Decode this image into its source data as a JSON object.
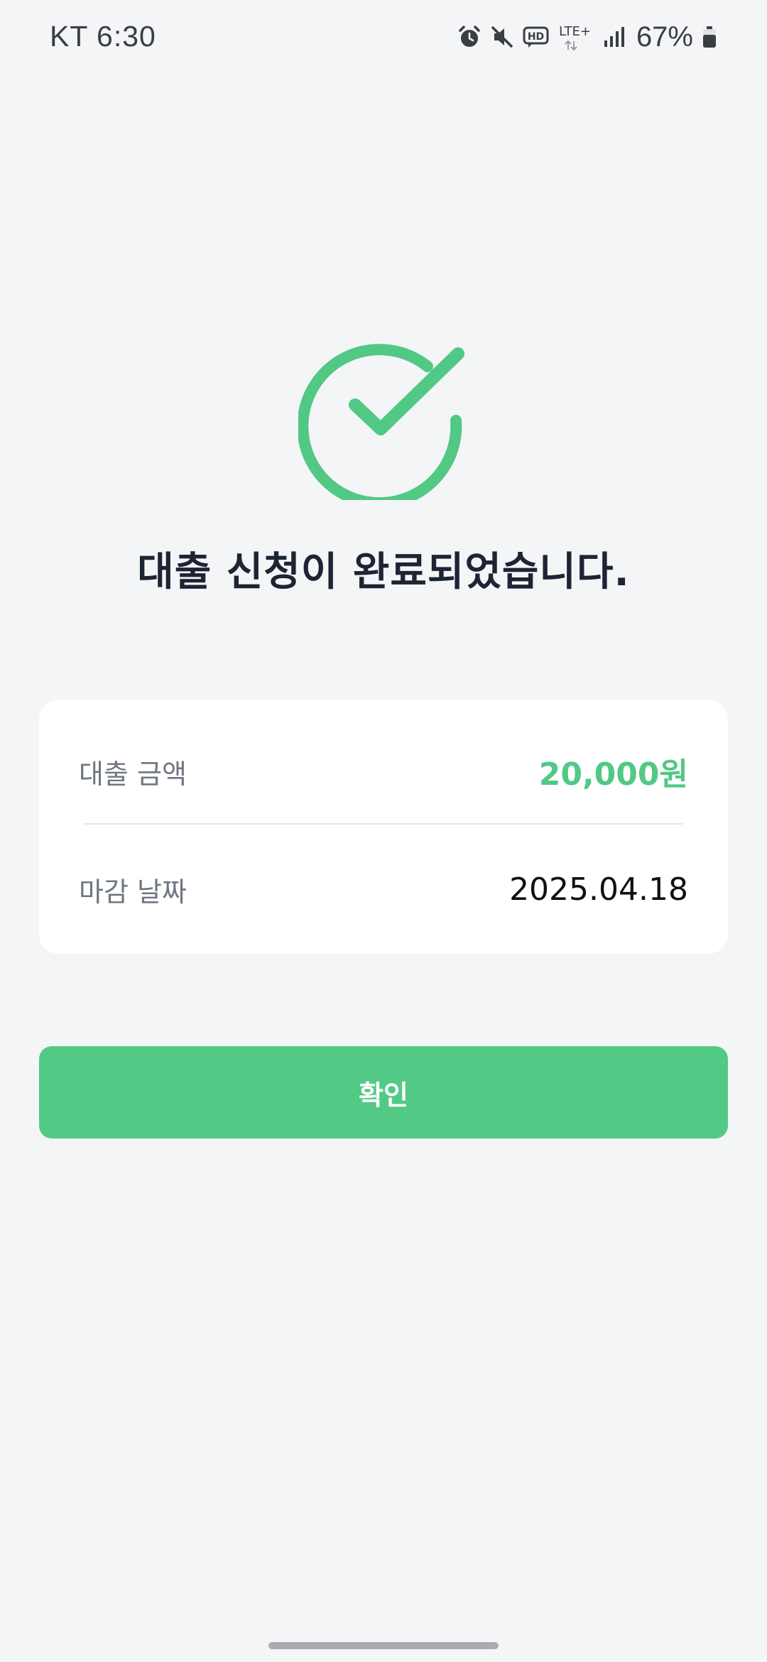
{
  "status_bar": {
    "carrier_time": "KT 6:30",
    "network_label": "LTE+",
    "battery": "67%",
    "icons": [
      "alarm-icon",
      "mute-icon",
      "hd-voice-icon",
      "lte-plus-icon",
      "signal-icon",
      "battery-icon"
    ]
  },
  "success": {
    "icon": "check-circle-icon",
    "title": "대출 신청이 완료되었습니다."
  },
  "summary": {
    "amount_label": "대출 금액",
    "amount_value": "20,000원",
    "due_label": "마감 날짜",
    "due_value": "2025.04.18"
  },
  "actions": {
    "confirm_label": "확인"
  },
  "colors": {
    "accent": "#52c885",
    "background": "#f4f5f7",
    "card": "#ffffff",
    "title": "#1d2434",
    "label": "#6f7682"
  }
}
